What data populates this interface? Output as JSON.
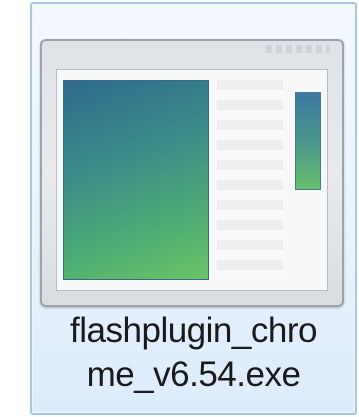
{
  "file": {
    "name_line_1": "flashplugin_chro",
    "name_line_2": "me_v6.54.exe",
    "icon": "exe-window-icon",
    "selected": true
  },
  "colors": {
    "selection_border": "#a9c6e6",
    "selection_fill": "#eaf3fd",
    "icon_frame": "#dfe3e7",
    "preview_start": "#2f6a8c",
    "preview_end": "#6ac565"
  }
}
